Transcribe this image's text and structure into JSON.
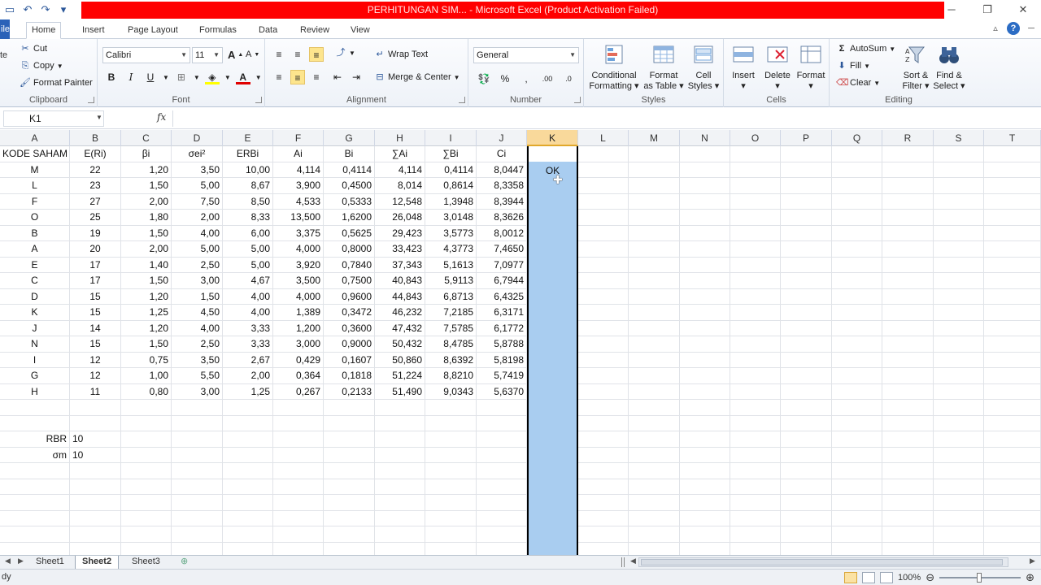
{
  "window": {
    "title": "PERHITUNGAN SIM... - Microsoft Excel (Product Activation Failed)"
  },
  "tabs": {
    "file": "ile",
    "home": "Home",
    "insert": "Insert",
    "page_layout": "Page Layout",
    "formulas": "Formulas",
    "data": "Data",
    "review": "Review",
    "view": "View"
  },
  "ribbon": {
    "clipboard": {
      "cut": "Cut",
      "copy": "Copy",
      "format_painter": "Format Painter",
      "label": "Clipboard",
      "paste_partial": "te"
    },
    "font": {
      "name": "Calibri",
      "size": "11",
      "label": "Font"
    },
    "alignment": {
      "wrap_text": "Wrap Text",
      "merge_center": "Merge & Center",
      "label": "Alignment"
    },
    "number": {
      "format": "General",
      "label": "Number"
    },
    "styles": {
      "conditional_formatting": [
        "Conditional",
        "Formatting"
      ],
      "format_as_table": [
        "Format",
        "as Table"
      ],
      "cell_styles": [
        "Cell",
        "Styles"
      ],
      "label": "Styles"
    },
    "cells": {
      "insert": "Insert",
      "delete": "Delete",
      "format": "Format",
      "label": "Cells"
    },
    "editing": {
      "autosum": "AutoSum",
      "fill": "Fill",
      "clear": "Clear",
      "sort_filter": [
        "Sort &",
        "Filter"
      ],
      "find_select": [
        "Find &",
        "Select"
      ],
      "label": "Editing"
    }
  },
  "formula_bar": {
    "name_box": "K1",
    "fx": "fx",
    "formula": ""
  },
  "columns": [
    "A",
    "B",
    "C",
    "D",
    "E",
    "F",
    "G",
    "H",
    "I",
    "J",
    "K",
    "L",
    "M",
    "N",
    "O",
    "P",
    "Q",
    "R",
    "S",
    "T"
  ],
  "header_row": [
    "KODE SAHAM",
    "E(Ri)",
    "βi",
    "σei²",
    "ERBi",
    "Ai",
    "Bi",
    "∑Ai",
    "∑Bi",
    "Ci"
  ],
  "rows": [
    [
      "M",
      "22",
      "1,20",
      "3,50",
      "10,00",
      "4,114",
      "0,4114",
      "4,114",
      "0,4114",
      "8,0447"
    ],
    [
      "L",
      "23",
      "1,50",
      "5,00",
      "8,67",
      "3,900",
      "0,4500",
      "8,014",
      "0,8614",
      "8,3358"
    ],
    [
      "F",
      "27",
      "2,00",
      "7,50",
      "8,50",
      "4,533",
      "0,5333",
      "12,548",
      "1,3948",
      "8,3944"
    ],
    [
      "O",
      "25",
      "1,80",
      "2,00",
      "8,33",
      "13,500",
      "1,6200",
      "26,048",
      "3,0148",
      "8,3626"
    ],
    [
      "B",
      "19",
      "1,50",
      "4,00",
      "6,00",
      "3,375",
      "0,5625",
      "29,423",
      "3,5773",
      "8,0012"
    ],
    [
      "A",
      "20",
      "2,00",
      "5,00",
      "5,00",
      "4,000",
      "0,8000",
      "33,423",
      "4,3773",
      "7,4650"
    ],
    [
      "E",
      "17",
      "1,40",
      "2,50",
      "5,00",
      "3,920",
      "0,7840",
      "37,343",
      "5,1613",
      "7,0977"
    ],
    [
      "C",
      "17",
      "1,50",
      "3,00",
      "4,67",
      "3,500",
      "0,7500",
      "40,843",
      "5,9113",
      "6,7944"
    ],
    [
      "D",
      "15",
      "1,20",
      "1,50",
      "4,00",
      "4,000",
      "0,9600",
      "44,843",
      "6,8713",
      "6,4325"
    ],
    [
      "K",
      "15",
      "1,25",
      "4,50",
      "4,00",
      "1,389",
      "0,3472",
      "46,232",
      "7,2185",
      "6,3171"
    ],
    [
      "J",
      "14",
      "1,20",
      "4,00",
      "3,33",
      "1,200",
      "0,3600",
      "47,432",
      "7,5785",
      "6,1772"
    ],
    [
      "N",
      "15",
      "1,50",
      "2,50",
      "3,33",
      "3,000",
      "0,9000",
      "50,432",
      "8,4785",
      "5,8788"
    ],
    [
      "I",
      "12",
      "0,75",
      "3,50",
      "2,67",
      "0,429",
      "0,1607",
      "50,860",
      "8,6392",
      "5,8198"
    ],
    [
      "G",
      "12",
      "1,00",
      "5,50",
      "2,00",
      "0,364",
      "0,1818",
      "51,224",
      "8,8210",
      "5,7419"
    ],
    [
      "H",
      "11",
      "0,80",
      "3,00",
      "1,25",
      "0,267",
      "0,2133",
      "51,490",
      "9,0343",
      "5,6370"
    ]
  ],
  "params": [
    {
      "label": "RBR",
      "value": "10"
    },
    {
      "label": "σm",
      "value": "10"
    }
  ],
  "selected_cell_text": "OK",
  "sheets": [
    "Sheet1",
    "Sheet2",
    "Sheet3"
  ],
  "active_sheet": "Sheet2",
  "status": {
    "text": "dy",
    "zoom": "100%"
  }
}
